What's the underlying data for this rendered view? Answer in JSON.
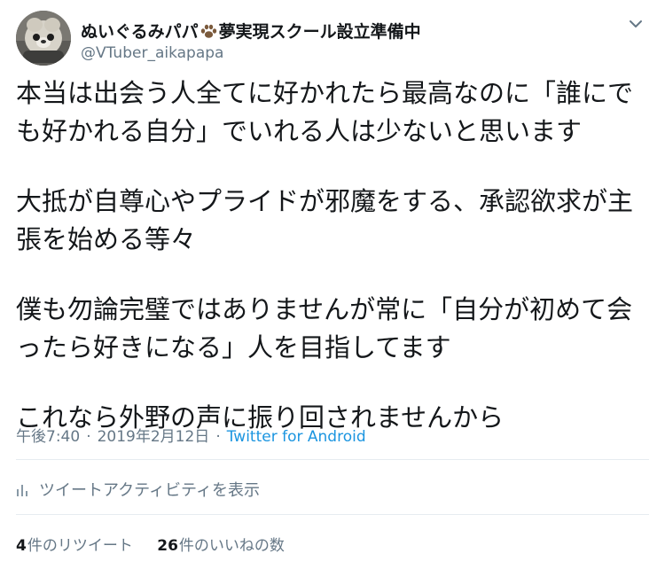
{
  "user": {
    "display_name": "ぬいぐるみパパ",
    "name_suffix": "夢実現スクール設立準備中",
    "name_icon": "paw-icon",
    "handle": "@VTuber_aikapapa"
  },
  "tweet": {
    "paragraphs": [
      [
        "本当は出会う人全てに好かれたら最高なのに「誰にで",
        "も好かれる自分」でいれる人は少ないと思います"
      ],
      [
        "大抵が自尊心やプライドが邪魔をする、承認欲求が主",
        "張を始める等々"
      ],
      [
        "僕も勿論完璧ではありませんが常に「自分が初めて会",
        "ったら好きになる」人を目指してます"
      ],
      [
        "これなら外野の声に振り回されませんから"
      ]
    ]
  },
  "meta": {
    "time": "午後7:40",
    "separator": "·",
    "date": "2019年2月12日",
    "source": "Twitter for Android"
  },
  "activity": {
    "label": "ツイートアクティビティを表示",
    "icon": "bar-chart-icon"
  },
  "stats": {
    "retweets": {
      "count": "4",
      "label": "件のリツイート"
    },
    "likes": {
      "count": "26",
      "label": "件のいいねの数"
    }
  },
  "colors": {
    "text": "#14171a",
    "secondary": "#657786",
    "link": "#1b95e0",
    "divider": "#e6ecf0"
  },
  "menu_icon": "chevron-down-icon"
}
